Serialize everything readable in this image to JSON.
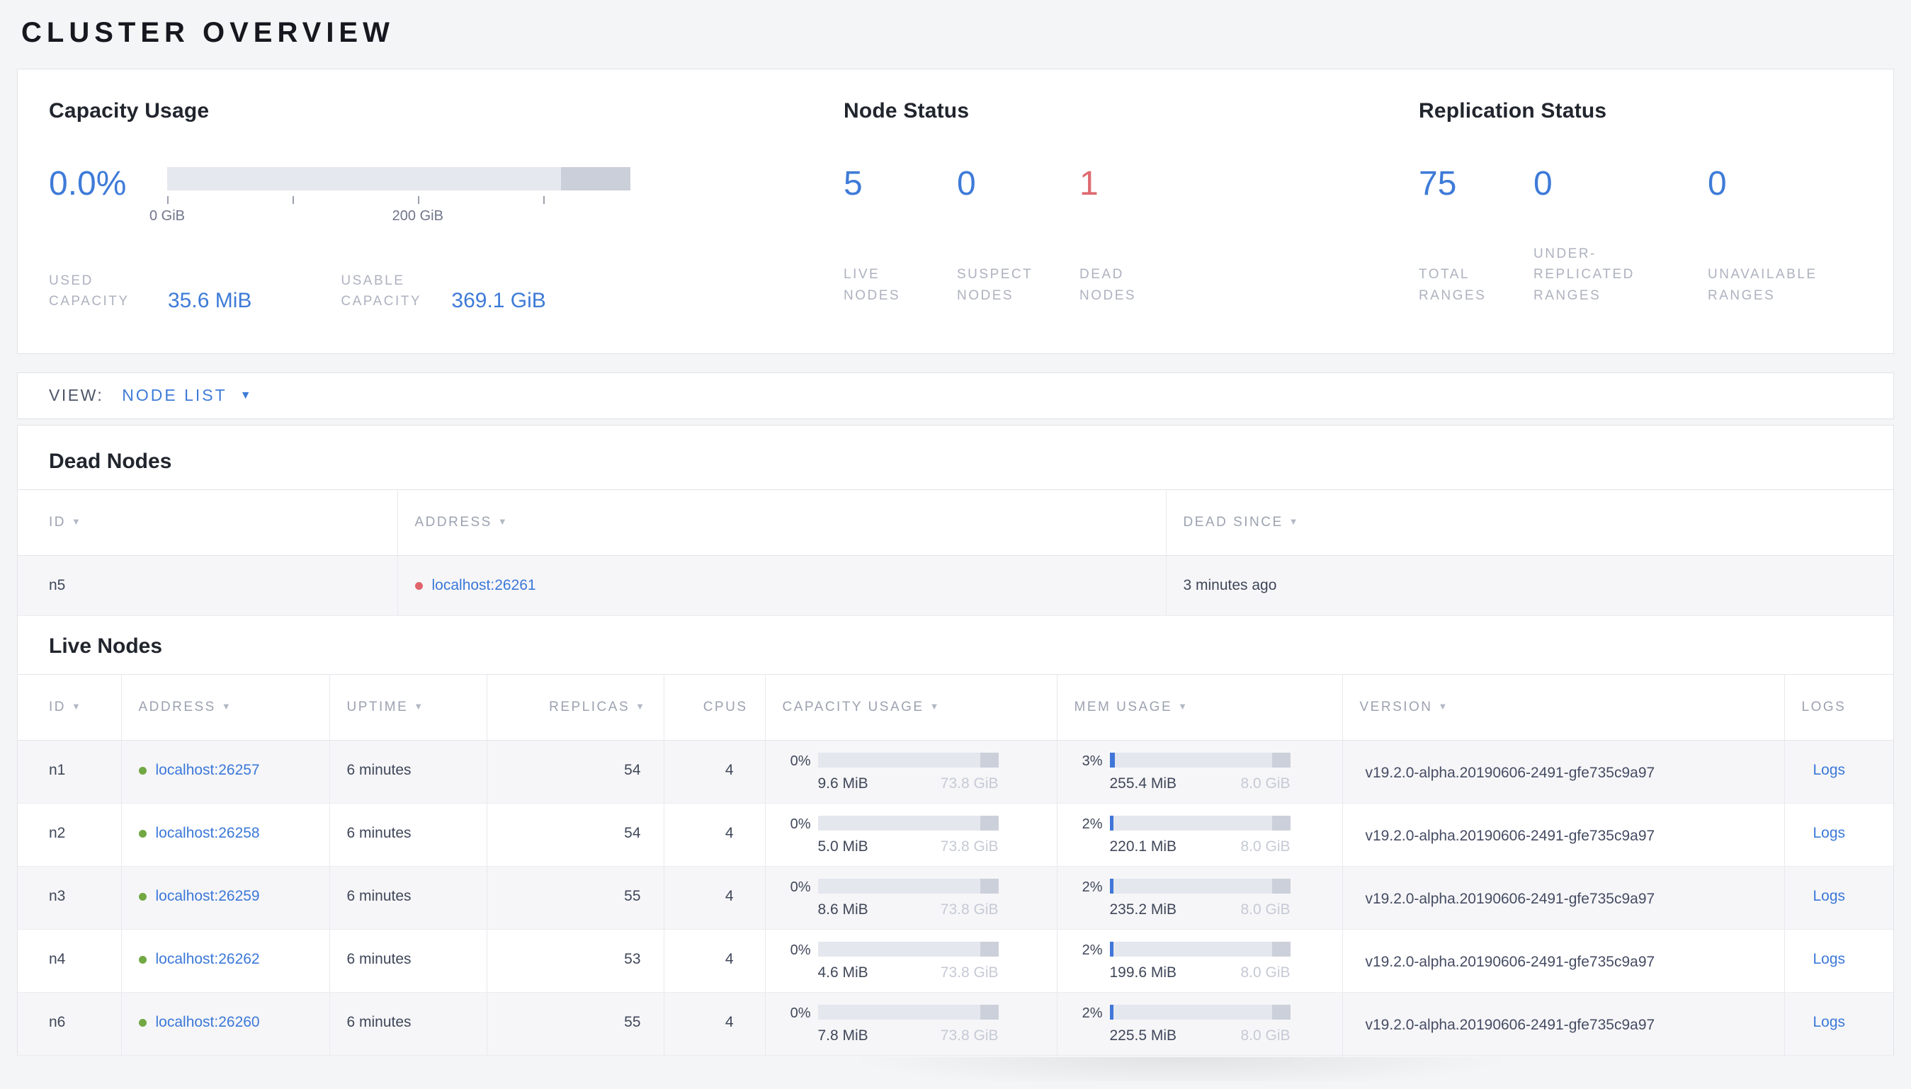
{
  "page": {
    "title": "CLUSTER OVERVIEW"
  },
  "icons": {
    "sort_arrow": "▼",
    "caret_down": "▼"
  },
  "colors": {
    "accent_blue": "#3e7bd8",
    "danger_red": "#de6b71",
    "live_green": "#71a843"
  },
  "summary": {
    "capacity": {
      "title": "Capacity Usage",
      "percent": "0.0%",
      "bar": {
        "dark_segment_start_pct": 85,
        "dark_segment_width_pct": 15
      },
      "ticks": [
        {
          "pos_pct": 0,
          "label": "0 GiB"
        },
        {
          "pos_pct": 27.1,
          "label": ""
        },
        {
          "pos_pct": 54.1,
          "label": "200 GiB"
        },
        {
          "pos_pct": 81.2,
          "label": ""
        }
      ],
      "used_label": "USED\nCAPACITY",
      "used_value": "35.6 MiB",
      "usable_label": "USABLE\nCAPACITY",
      "usable_value": "369.1 GiB"
    },
    "node_status": {
      "title": "Node Status",
      "metrics": [
        {
          "value": "5",
          "label": "LIVE\nNODES"
        },
        {
          "value": "0",
          "label": "SUSPECT\nNODES"
        },
        {
          "value": "1",
          "label": "DEAD\nNODES"
        }
      ]
    },
    "replication": {
      "title": "Replication Status",
      "metrics": [
        {
          "value": "75",
          "label": "TOTAL\nRANGES"
        },
        {
          "value": "0",
          "label": "UNDER-\nREPLICATED\nRANGES"
        },
        {
          "value": "0",
          "label": "UNAVAILABLE\nRANGES"
        }
      ]
    }
  },
  "view_bar": {
    "label": "VIEW:",
    "selected": "NODE LIST"
  },
  "dead_nodes": {
    "heading": "Dead Nodes",
    "columns": {
      "id": "ID",
      "address": "ADDRESS",
      "dead_since": "DEAD SINCE"
    },
    "rows": [
      {
        "id": "n5",
        "address": "localhost:26261",
        "dead_since": "3 minutes ago"
      }
    ]
  },
  "live_nodes": {
    "heading": "Live Nodes",
    "columns": {
      "id": "ID",
      "address": "ADDRESS",
      "uptime": "UPTIME",
      "replicas": "REPLICAS",
      "cpus": "CPUS",
      "capacity": "CAPACITY USAGE",
      "mem": "MEM USAGE",
      "version": "VERSION",
      "logs": "LOGS"
    },
    "rows": [
      {
        "id": "n1",
        "address": "localhost:26257",
        "uptime": "6 minutes",
        "replicas": "54",
        "cpus": "4",
        "capacity": {
          "pct_label": "0%",
          "fill_pct": 0,
          "used": "9.6 MiB",
          "total": "73.8 GiB"
        },
        "mem": {
          "pct_label": "3%",
          "fill_pct": 3,
          "used": "255.4 MiB",
          "total": "8.0 GiB"
        },
        "version": "v19.2.0-alpha.20190606-2491-gfe735c9a97",
        "logs_label": "Logs"
      },
      {
        "id": "n2",
        "address": "localhost:26258",
        "uptime": "6 minutes",
        "replicas": "54",
        "cpus": "4",
        "capacity": {
          "pct_label": "0%",
          "fill_pct": 0,
          "used": "5.0 MiB",
          "total": "73.8 GiB"
        },
        "mem": {
          "pct_label": "2%",
          "fill_pct": 2,
          "used": "220.1 MiB",
          "total": "8.0 GiB"
        },
        "version": "v19.2.0-alpha.20190606-2491-gfe735c9a97",
        "logs_label": "Logs"
      },
      {
        "id": "n3",
        "address": "localhost:26259",
        "uptime": "6 minutes",
        "replicas": "55",
        "cpus": "4",
        "capacity": {
          "pct_label": "0%",
          "fill_pct": 0,
          "used": "8.6 MiB",
          "total": "73.8 GiB"
        },
        "mem": {
          "pct_label": "2%",
          "fill_pct": 2,
          "used": "235.2 MiB",
          "total": "8.0 GiB"
        },
        "version": "v19.2.0-alpha.20190606-2491-gfe735c9a97",
        "logs_label": "Logs"
      },
      {
        "id": "n4",
        "address": "localhost:26262",
        "uptime": "6 minutes",
        "replicas": "53",
        "cpus": "4",
        "capacity": {
          "pct_label": "0%",
          "fill_pct": 0,
          "used": "4.6 MiB",
          "total": "73.8 GiB"
        },
        "mem": {
          "pct_label": "2%",
          "fill_pct": 2,
          "used": "199.6 MiB",
          "total": "8.0 GiB"
        },
        "version": "v19.2.0-alpha.20190606-2491-gfe735c9a97",
        "logs_label": "Logs"
      },
      {
        "id": "n6",
        "address": "localhost:26260",
        "uptime": "6 minutes",
        "replicas": "55",
        "cpus": "4",
        "capacity": {
          "pct_label": "0%",
          "fill_pct": 0,
          "used": "7.8 MiB",
          "total": "73.8 GiB"
        },
        "mem": {
          "pct_label": "2%",
          "fill_pct": 2,
          "used": "225.5 MiB",
          "total": "8.0 GiB"
        },
        "version": "v19.2.0-alpha.20190606-2491-gfe735c9a97",
        "logs_label": "Logs"
      }
    ]
  }
}
